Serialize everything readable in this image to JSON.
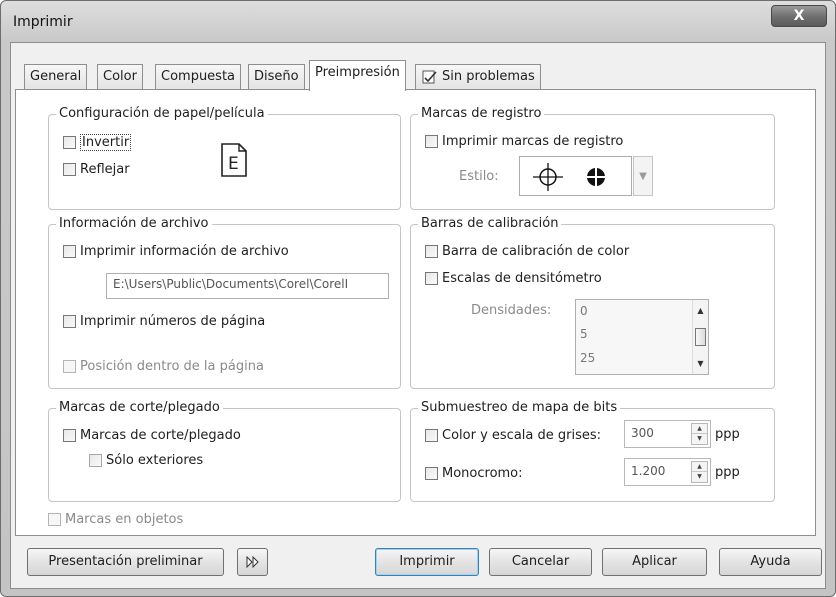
{
  "window": {
    "title": "Imprimir",
    "close_glyph": "X"
  },
  "tabs": [
    {
      "label": "General"
    },
    {
      "label": "Color"
    },
    {
      "label": "Compuesta"
    },
    {
      "label": "Diseño"
    },
    {
      "label": "Preimpresión"
    },
    {
      "label": "Sin problemas",
      "icon": "checklist-icon"
    }
  ],
  "paper": {
    "title": "Configuración de papel/película",
    "invert": "Invertir",
    "mirror": "Reflejar",
    "icon": "page-orientation-icon",
    "preview_glyph": "E"
  },
  "registration": {
    "title": "Marcas de registro",
    "print_marks": "Imprimir marcas de registro",
    "style_label": "Estilo:",
    "icons": [
      "crosshair-icon",
      "filled-target-icon"
    ]
  },
  "fileinfo": {
    "title": "Información de archivo",
    "print_info": "Imprimir información de archivo",
    "path": "E:\\Users\\Public\\Documents\\Corel\\CorelI",
    "page_numbers": "Imprimir números de página",
    "position_in_page": "Posición dentro de la página"
  },
  "calibration": {
    "title": "Barras de calibración",
    "color_bar": "Barra de calibración de color",
    "densitometer": "Escalas de densitómetro",
    "densities_label": "Densidades:",
    "densities": [
      "0",
      "5",
      "25"
    ]
  },
  "crop": {
    "title": "Marcas de corte/plegado",
    "crop_marks": "Marcas de corte/plegado",
    "exterior_only": "Sólo exteriores"
  },
  "bitmap": {
    "title": "Submuestreo de mapa de bits",
    "color_gray": "Color y escala de grises:",
    "color_value": "300",
    "mono": "Monocromo:",
    "mono_value": "1.200",
    "unit": "ppp"
  },
  "marks_on_objects": "Marcas en objetos",
  "buttons": {
    "preview": "Presentación preliminar",
    "print": "Imprimir",
    "cancel": "Cancelar",
    "apply": "Aplicar",
    "help": "Ayuda"
  },
  "colors": {
    "default_button_border": "#3c7fb1",
    "disabled_text": "#8a8a8a"
  }
}
